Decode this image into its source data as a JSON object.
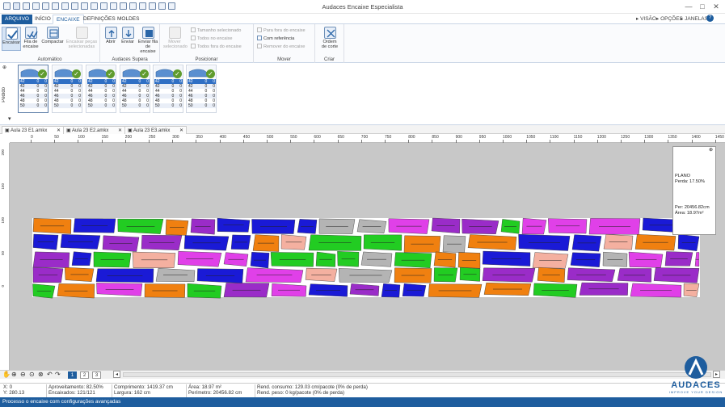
{
  "window": {
    "title": "Audaces Encaixe Especialista",
    "controls": [
      "—",
      "□",
      "✕"
    ]
  },
  "ribbon_tabs": [
    {
      "label": "ARQUIVO"
    },
    {
      "label": "INÍCIO"
    },
    {
      "label": "ENCAIXE"
    },
    {
      "label": "DEFINIÇÕES"
    },
    {
      "label": "MOLDES"
    }
  ],
  "ribbon_right": {
    "visao": "VISÃO",
    "opcoes": "OPÇÕES",
    "janelas": "JANELAS"
  },
  "ribbon": {
    "automatico": {
      "label": "Automático",
      "buttons": [
        "Encaixar",
        "Fila de encaixe",
        "Compactar",
        "Encaixar peças selecionadas"
      ]
    },
    "audaces_supera": {
      "label": "Audaces Supera",
      "buttons": [
        "Abrir",
        "Enviar",
        "Enviar fila de encaixe"
      ]
    },
    "posicionar": {
      "label": "Posicionar",
      "big": "Mover selecionado",
      "small": [
        "Tamanho selecionado",
        "Todos no encaixe",
        "Todos fora do encaixe"
      ]
    },
    "mover": {
      "label": "Mover",
      "small": [
        "Para fora do encaixe",
        "Com referência",
        "Remover do encaixe"
      ]
    },
    "criar": {
      "label": "Criar",
      "buttons": [
        "Ordem de corte"
      ]
    }
  },
  "piece_panel": {
    "side_label": "Pedido",
    "cards": [
      {
        "rows": [
          [
            "42",
            "0",
            "0"
          ],
          [
            "42",
            "0",
            "0"
          ],
          [
            "44",
            "0",
            "0"
          ],
          [
            "46",
            "0",
            "0"
          ],
          [
            "48",
            "0",
            "0"
          ],
          [
            "50",
            "0",
            "0"
          ]
        ],
        "highlight": 0
      },
      {
        "rows": [
          [
            "42",
            "0",
            "0"
          ],
          [
            "42",
            "0",
            "0"
          ],
          [
            "44",
            "0",
            "0"
          ],
          [
            "46",
            "0",
            "0"
          ],
          [
            "48",
            "0",
            "0"
          ],
          [
            "50",
            "0",
            "0"
          ]
        ],
        "highlight": 0
      },
      {
        "rows": [
          [
            "42",
            "0",
            "0"
          ],
          [
            "42",
            "0",
            "0"
          ],
          [
            "44",
            "0",
            "0"
          ],
          [
            "46",
            "0",
            "0"
          ],
          [
            "48",
            "0",
            "0"
          ],
          [
            "50",
            "0",
            "0"
          ]
        ],
        "highlight": 0
      },
      {
        "rows": [
          [
            "42",
            "0",
            "0"
          ],
          [
            "42",
            "0",
            "0"
          ],
          [
            "44",
            "0",
            "0"
          ],
          [
            "46",
            "0",
            "0"
          ],
          [
            "48",
            "0",
            "0"
          ],
          [
            "50",
            "0",
            "0"
          ]
        ],
        "highlight": 0
      },
      {
        "rows": [
          [
            "42",
            "0",
            "0"
          ],
          [
            "42",
            "0",
            "0"
          ],
          [
            "44",
            "0",
            "0"
          ],
          [
            "46",
            "0",
            "0"
          ],
          [
            "48",
            "0",
            "0"
          ],
          [
            "50",
            "0",
            "0"
          ]
        ],
        "highlight": 0
      },
      {
        "rows": [
          [
            "42",
            "0",
            "0"
          ],
          [
            "42",
            "0",
            "0"
          ],
          [
            "44",
            "0",
            "0"
          ],
          [
            "46",
            "0",
            "0"
          ],
          [
            "48",
            "0",
            "0"
          ],
          [
            "50",
            "0",
            "0"
          ]
        ],
        "highlight": 0
      }
    ]
  },
  "doc_tabs": [
    {
      "label": "Aula 23 E1.amkx",
      "close": "✕"
    },
    {
      "label": "Aula 23 E2.amkx",
      "close": "✕"
    },
    {
      "label": "Aula 23 E3.amkx",
      "close": "✕"
    }
  ],
  "ruler": {
    "top": [
      "0",
      "50",
      "100",
      "150",
      "200",
      "250",
      "300",
      "350",
      "400",
      "450",
      "500",
      "550",
      "600",
      "650",
      "700",
      "750",
      "800",
      "850",
      "900",
      "950",
      "1000",
      "1050",
      "1100",
      "1150",
      "1200",
      "1250",
      "1300",
      "1350",
      "1400",
      "1450"
    ],
    "left": [
      "200",
      "150",
      "100",
      "50",
      "0"
    ]
  },
  "plano": {
    "title": "PLANO",
    "perda": "Perda: 17.50%",
    "per": "Per: 20456.82cm",
    "area": "Área: 18.97m²"
  },
  "pages": [
    "1",
    "2",
    "3"
  ],
  "status": {
    "x": "X: 0",
    "y": "Y: 280.13",
    "aproveitamento": "Aproveitamento: 82.50%",
    "encaixados": "Encaixados: 121/121",
    "comprimento": "Comprimento: 1419.37 cm",
    "largura": "Largura: 162 cm",
    "area": "Área: 18.97 m²",
    "perimetro": "Perímetro: 20456.82 cm",
    "rend_consumo": "Rend. consumo: 129.03 cm/pacote (0% de perda)",
    "rend_peso": "Rend. peso: 0 kg/pacote (0% de perda)"
  },
  "bottom_message": "Processo o encaixe com configurações avançadas",
  "logo": {
    "text": "AUDACES",
    "tagline": "IMPROVE YOUR DESIGN"
  },
  "colors": {
    "accent": "#1e5d9e",
    "canvas_bg": "#c8c8c8",
    "marker_bg": "#ffffff",
    "piece_magenta": "#e040e8",
    "piece_green": "#22cc22",
    "piece_blue": "#1a1ad6",
    "piece_orange": "#f08010",
    "piece_salmon": "#f4b0a0",
    "piece_gray": "#b4b4b4",
    "piece_purple": "#9a2cc8"
  }
}
